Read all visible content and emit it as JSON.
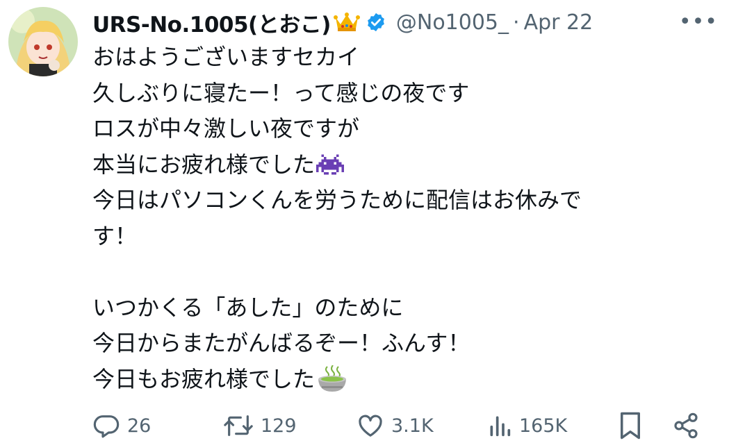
{
  "tweet": {
    "display_name": "URS-No.1005(とおこ)",
    "handle": "@No1005_",
    "separator": "·",
    "date": "Apr 22",
    "more": "•••",
    "lines": [
      "おはようございますセカイ",
      "久しぶりに寝たー！って感じの夜です",
      "ロスが中々激しい夜ですが",
      "本当にお疲れ様でした",
      "今日はパソコンくんを労うために配信はお休みで",
      "す！",
      "",
      "いつかくる「あした」のために",
      "今日からまたがんばるぞー！ふんす！",
      "今日もお疲れ様でした"
    ]
  },
  "actions": {
    "replies": "26",
    "reposts": "129",
    "likes": "3.1K",
    "views": "165K"
  },
  "icons": [
    "avatar",
    "crown-emoji",
    "verified-badge-icon",
    "more-icon",
    "space-invader-emoji",
    "tea-emoji",
    "reply-icon",
    "repost-icon",
    "like-icon",
    "views-icon",
    "bookmark-icon",
    "share-icon"
  ],
  "colors": {
    "verified": "#1d9bf0",
    "muted": "#536471",
    "text": "#0f1419"
  }
}
